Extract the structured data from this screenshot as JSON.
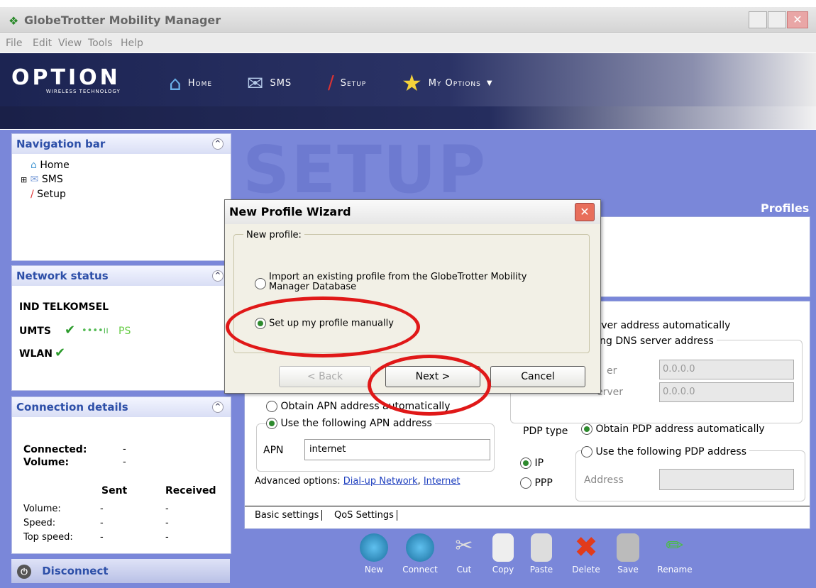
{
  "window": {
    "title": "GlobeTrotter Mobility Manager"
  },
  "menu": [
    "File",
    "Edit",
    "View",
    "Tools",
    "Help"
  ],
  "brand": {
    "logo": "OPTION",
    "tagline": "WIRELESS TECHNOLOGY"
  },
  "toolbar": {
    "home": "Home",
    "sms": "SMS",
    "setup": "Setup",
    "myoptions": "My Options"
  },
  "nav": {
    "title": "Navigation bar",
    "items": [
      "Home",
      "SMS",
      "Setup"
    ]
  },
  "network": {
    "title": "Network status",
    "operator": "IND TELKOMSEL",
    "umts": "UMTS",
    "ps": "PS",
    "wlan": "WLAN"
  },
  "connection": {
    "title": "Connection details",
    "connected": "Connected:",
    "volume": "Volume:",
    "dash": "-",
    "sent": "Sent",
    "received": "Received",
    "rows": [
      "Volume:",
      "Speed:",
      "Top speed:"
    ],
    "disconnect": "Disconnect"
  },
  "setup": {
    "banner": "SETUP",
    "profiles": "Profiles",
    "dns_auto": "erver address automatically",
    "dns_manual": "ving DNS server address",
    "dns_field_1_label": "er",
    "dns_field_2_label": "erver",
    "dns1": "0.0.0.0",
    "dns2": "0.0.0.0",
    "apn_auto": "Obtain APN address automatically",
    "apn_manual": "Use the following APN address",
    "apn_label": "APN",
    "apn_value": "internet",
    "pdp_type": "PDP type",
    "pdp_auto": "Obtain PDP address automatically",
    "pdp_manual": "Use the following PDP address",
    "ip": "IP",
    "ppp": "PPP",
    "address": "Address",
    "advanced": "Advanced options:",
    "dialup": "Dial-up Network",
    "comma": ",",
    "internet": "Internet",
    "tab_basic": "Basic settings",
    "tab_qos": "QoS Settings"
  },
  "bottom": [
    "New",
    "Connect",
    "Cut",
    "Copy",
    "Paste",
    "Delete",
    "Save",
    "Rename"
  ],
  "dialog": {
    "title": "New Profile Wizard",
    "group": "New profile:",
    "option1": "Import an existing profile from the GlobeTrotter Mobility Manager Database",
    "option2": "Set up my profile manually",
    "back": "< Back",
    "next": "Next >",
    "cancel": "Cancel"
  },
  "colors": {
    "accent": "#7a87d9",
    "highlight": "#e01818",
    "nav_text": "#2d4fa8"
  }
}
